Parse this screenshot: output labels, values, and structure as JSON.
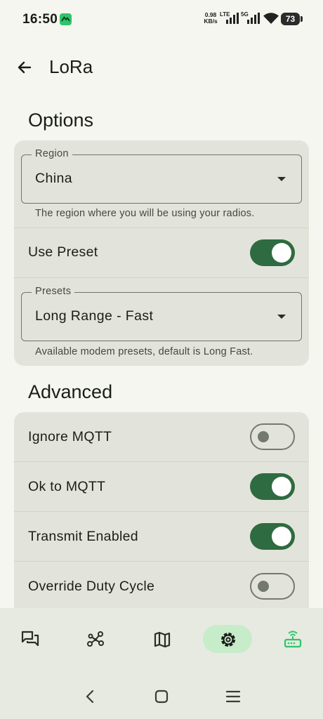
{
  "status_bar": {
    "time": "16:50",
    "net_speed_value": "0.98",
    "net_speed_unit": "KB/s",
    "network_lte": "LTE",
    "network_5g": "5G",
    "battery": "73"
  },
  "top_bar": {
    "title": "LoRa"
  },
  "options": {
    "title": "Options",
    "region": {
      "label": "Region",
      "value": "China",
      "helper": "The region where you will be using your radios."
    },
    "use_preset": {
      "label": "Use Preset",
      "on": true
    },
    "presets": {
      "label": "Presets",
      "value": "Long Range - Fast",
      "helper": "Available modem presets, default is Long Fast."
    }
  },
  "advanced": {
    "title": "Advanced",
    "items": [
      {
        "label": "Ignore MQTT",
        "on": false
      },
      {
        "label": "Ok to MQTT",
        "on": true
      },
      {
        "label": "Transmit Enabled",
        "on": true
      },
      {
        "label": "Override Duty Cycle",
        "on": false
      }
    ]
  },
  "bottom_nav": {
    "items": [
      "messages-icon",
      "nodes-icon",
      "map-icon",
      "settings-icon",
      "device-connected-icon"
    ],
    "active": "settings-icon"
  },
  "colors": {
    "background": "#f4f6ef",
    "card": "#e2e4db",
    "switch_on": "#2e6b40",
    "nav_active": "#c6ecca",
    "connected": "#2fc46a"
  }
}
